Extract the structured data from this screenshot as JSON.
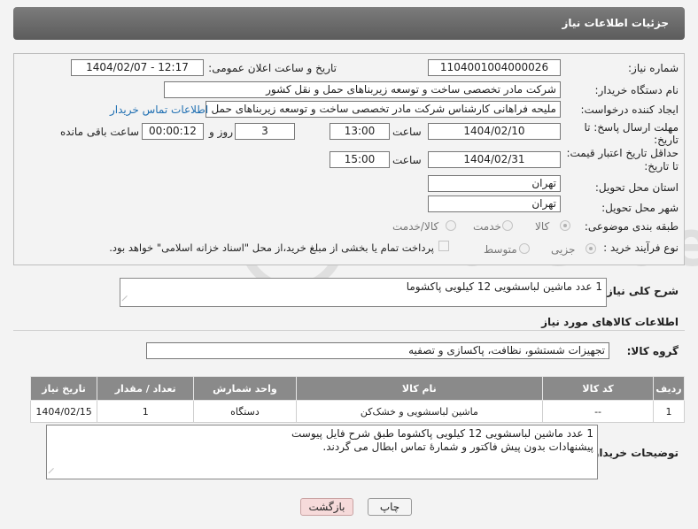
{
  "header": {
    "title": "جزئیات اطلاعات نیاز"
  },
  "form": {
    "need_number_label": "شماره نیاز:",
    "need_number": "1104001004000026",
    "announce_label": "تاریخ و ساعت اعلان عمومی:",
    "announce_value": "1404/02/07 - 12:17",
    "buyer_org_label": "نام دستگاه خریدار:",
    "buyer_org": "شرکت مادر تخصصی ساخت و توسعه زیربناهای حمل و نقل کشور",
    "creator_label": "ایجاد کننده درخواست:",
    "creator": "ملیحه فراهانی کارشناس شرکت مادر تخصصی ساخت و توسعه زیربناهای حمل",
    "contact_link": "اطلاعات تماس خریدار",
    "deadline_label_1": "مهلت ارسال پاسخ: تا",
    "deadline_label_2": "تاریخ:",
    "deadline_date": "1404/02/10",
    "time_label": "ساعت",
    "deadline_time": "13:00",
    "days_value": "3",
    "days_label": "روز و",
    "remaining_time": "00:00:12",
    "remaining_label": "ساعت باقی مانده",
    "validity_label_1": "حداقل تاریخ اعتبار قیمت:",
    "validity_label_2": "تا تاریخ:",
    "validity_date": "1404/02/31",
    "validity_time_label": "ساعت",
    "validity_time": "15:00",
    "province_label": "استان محل تحویل:",
    "province": "تهران",
    "city_label": "شهر محل تحویل:",
    "city": "تهران",
    "category_label": "طبقه بندی موضوعی:",
    "category_options": [
      "کالا",
      "خدمت",
      "کالا/خدمت"
    ],
    "category_selected": "کالا",
    "process_label": "نوع فرآیند خرید :",
    "process_options": [
      "جزیی",
      "متوسط"
    ],
    "process_selected": "جزیی",
    "payment_note": "پرداخت تمام یا بخشی از مبلغ خرید،از محل \"اسناد خزانه اسلامی\" خواهد بود."
  },
  "summary": {
    "label": "شرح کلی نیاز:",
    "value": "1 عدد ماشین لباسشویی 12 کیلویی پاکشوما"
  },
  "goods": {
    "section_title": "اطلاعات کالاهای مورد نیاز",
    "group_label": "گروه کالا:",
    "group_value": "تجهیزات شستشو، نظافت، پاکسازی و تصفیه",
    "columns": [
      "ردیف",
      "کد کالا",
      "نام کالا",
      "واحد شمارش",
      "تعداد / مقدار",
      "تاریخ نیاز"
    ],
    "rows": [
      {
        "index": "1",
        "code": "--",
        "name": "ماشین لباسشویی و خشک‌کن",
        "unit": "دستگاه",
        "qty": "1",
        "date": "1404/02/15"
      }
    ]
  },
  "buyer_notes": {
    "label": "توضیحات خریدار:",
    "line1": "1 عدد ماشین لباسشویی 12 کیلویی پاکشوما طبق شرح فایل پیوست",
    "line2": "پیشنهادات بدون پیش فاکتور و شمارۀ تماس ابطال می گردند."
  },
  "buttons": {
    "print": "چاپ",
    "back": "بازگشت"
  },
  "watermark": {
    "text": "AriaTender.neT"
  },
  "colors": {
    "header_bg": "#6b6b6b",
    "table_header": "#8a8a8a",
    "link": "#1f6fb2",
    "back_button": "#f6dada"
  }
}
